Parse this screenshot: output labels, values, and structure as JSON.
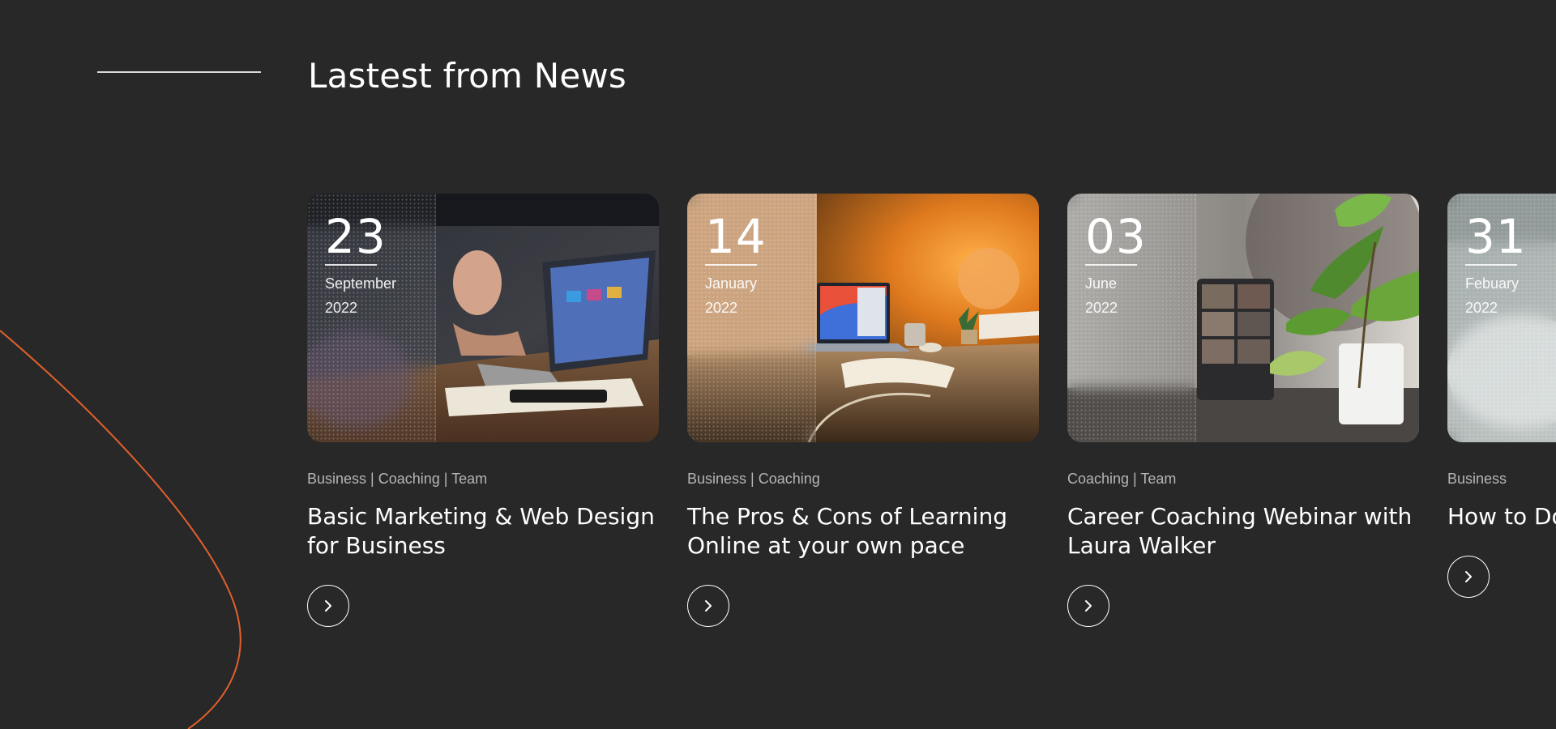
{
  "section": {
    "title": "Lastest from News"
  },
  "colors": {
    "background": "#282828",
    "accent_curve": "#e2602c",
    "text": "#ffffff",
    "muted_text": "#b5b5b5"
  },
  "cards": [
    {
      "day": "23",
      "month": "September",
      "year": "2022",
      "categories": "Business | Coaching | Team",
      "title": "Basic Marketing & Web Design for Business",
      "image_icon": "laptop-meeting-photo",
      "button_icon": "chevron-right-icon"
    },
    {
      "day": "14",
      "month": "January",
      "year": "2022",
      "categories": "Business | Coaching",
      "title": "The Pros & Cons of Learning Online at your own pace",
      "image_icon": "desk-lamp-laptop-photo",
      "button_icon": "chevron-right-icon"
    },
    {
      "day": "03",
      "month": "June",
      "year": "2022",
      "categories": "Coaching | Team",
      "title": "Career Coaching Webinar with Laura Walker",
      "image_icon": "plant-video-call-photo",
      "button_icon": "chevron-right-icon"
    },
    {
      "day": "31",
      "month": "Febuary",
      "year": "2022",
      "categories": "Business",
      "title": "How to Do Business",
      "image_icon": "office-photo",
      "button_icon": "chevron-right-icon"
    }
  ]
}
